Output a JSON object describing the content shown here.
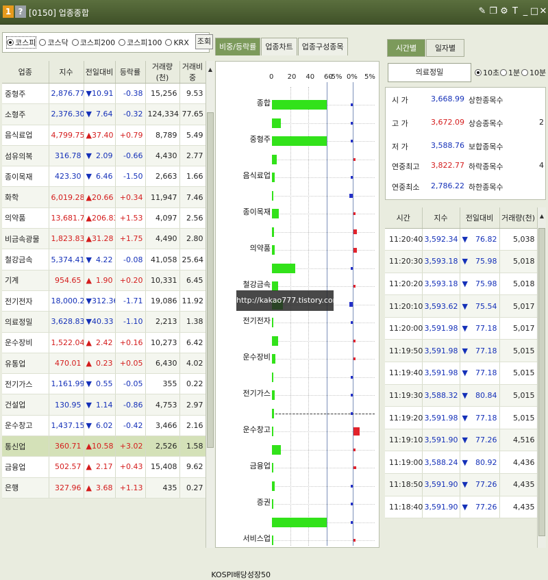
{
  "title": {
    "code": "[0150] 업종종합",
    "badge1": "1",
    "badge2": "?",
    "icons": [
      "handwrite-icon",
      "copy-icon",
      "settings-icon",
      "text-icon"
    ],
    "controls": [
      "minimize-icon",
      "maximize-icon",
      "close-icon"
    ]
  },
  "market_filter": {
    "options": [
      "코스피",
      "코스닥",
      "코스피200",
      "코스피100",
      "KRX"
    ],
    "selected": "코스피",
    "query_label": "조회"
  },
  "sector_table": {
    "headers": [
      "업종",
      "지수",
      "전일대비",
      "등락률",
      "거래량(천)",
      "거래비중"
    ],
    "rows": [
      {
        "name": "중형주",
        "index": "2,876.77",
        "arrow": "▼",
        "change": "10.91",
        "rate": "-0.38",
        "volume": "15,256",
        "share": "9.53",
        "dir": "down"
      },
      {
        "name": "소형주",
        "index": "2,376.30",
        "arrow": "▼",
        "change": "7.64",
        "rate": "-0.32",
        "volume": "124,334",
        "share": "77.65",
        "dir": "down"
      },
      {
        "name": "음식료업",
        "index": "4,799.75",
        "arrow": "▲",
        "change": "37.40",
        "rate": "+0.79",
        "volume": "8,789",
        "share": "5.49",
        "dir": "up"
      },
      {
        "name": "섬유의복",
        "index": "316.78",
        "arrow": "▼",
        "change": "2.09",
        "rate": "-0.66",
        "volume": "4,430",
        "share": "2.77",
        "dir": "down"
      },
      {
        "name": "종이목재",
        "index": "423.30",
        "arrow": "▼",
        "change": "6.46",
        "rate": "-1.50",
        "volume": "2,663",
        "share": "1.66",
        "dir": "down"
      },
      {
        "name": "화학",
        "index": "6,019.28",
        "arrow": "▲",
        "change": "20.66",
        "rate": "+0.34",
        "volume": "11,947",
        "share": "7.46",
        "dir": "up"
      },
      {
        "name": "의약품",
        "index": "13,681.7",
        "arrow": "▲",
        "change": "206.83",
        "rate": "+1.53",
        "volume": "4,097",
        "share": "2.56",
        "dir": "up"
      },
      {
        "name": "비금속광물",
        "index": "1,823.83",
        "arrow": "▲",
        "change": "31.28",
        "rate": "+1.75",
        "volume": "4,490",
        "share": "2.80",
        "dir": "up"
      },
      {
        "name": "철강금속",
        "index": "5,374.41",
        "arrow": "▼",
        "change": "4.22",
        "rate": "-0.08",
        "volume": "41,058",
        "share": "25.64",
        "dir": "down"
      },
      {
        "name": "기계",
        "index": "954.65",
        "arrow": "▲",
        "change": "1.90",
        "rate": "+0.20",
        "volume": "10,331",
        "share": "6.45",
        "dir": "up"
      },
      {
        "name": "전기전자",
        "index": "18,000.2",
        "arrow": "▼",
        "change": "312.36",
        "rate": "-1.71",
        "volume": "19,086",
        "share": "11.92",
        "dir": "down"
      },
      {
        "name": "의료정밀",
        "index": "3,628.83",
        "arrow": "▼",
        "change": "40.33",
        "rate": "-1.10",
        "volume": "2,213",
        "share": "1.38",
        "dir": "down"
      },
      {
        "name": "운수장비",
        "index": "1,522.04",
        "arrow": "▲",
        "change": "2.42",
        "rate": "+0.16",
        "volume": "10,273",
        "share": "6.42",
        "dir": "up"
      },
      {
        "name": "유통업",
        "index": "470.01",
        "arrow": "▲",
        "change": "0.23",
        "rate": "+0.05",
        "volume": "6,430",
        "share": "4.02",
        "dir": "up"
      },
      {
        "name": "전기가스",
        "index": "1,161.99",
        "arrow": "▼",
        "change": "0.55",
        "rate": "-0.05",
        "volume": "355",
        "share": "0.22",
        "dir": "down"
      },
      {
        "name": "건설업",
        "index": "130.95",
        "arrow": "▼",
        "change": "1.14",
        "rate": "-0.86",
        "volume": "4,753",
        "share": "2.97",
        "dir": "down"
      },
      {
        "name": "운수창고",
        "index": "1,437.15",
        "arrow": "▼",
        "change": "6.02",
        "rate": "-0.42",
        "volume": "3,466",
        "share": "2.16",
        "dir": "down"
      },
      {
        "name": "통신업",
        "index": "360.71",
        "arrow": "▲",
        "change": "10.58",
        "rate": "+3.02",
        "volume": "2,526",
        "share": "1.58",
        "dir": "up"
      },
      {
        "name": "금융업",
        "index": "502.57",
        "arrow": "▲",
        "change": "2.17",
        "rate": "+0.43",
        "volume": "15,408",
        "share": "9.62",
        "dir": "up"
      },
      {
        "name": "은행",
        "index": "327.96",
        "arrow": "▲",
        "change": "3.68",
        "rate": "+1.13",
        "volume": "435",
        "share": "0.27",
        "dir": "up"
      }
    ]
  },
  "chart_tabs": [
    "비중/등락률",
    "업종차트",
    "업종구성종목"
  ],
  "chart_data": {
    "type": "bar",
    "share_axis_ticks": [
      "0",
      "20",
      "40",
      "60"
    ],
    "rate_axis_ticks": [
      "-5%",
      "0%",
      "5%"
    ],
    "shown_labels": [
      "종합",
      "중형주",
      "음식료업",
      "종이목재",
      "의약품",
      "철강금속",
      "전기전자",
      "운수장비",
      "전기가스",
      "운수창고",
      "금융업",
      "증권",
      "서비스업",
      "KOSPI배당성장50"
    ],
    "series": [
      {
        "name": "거래비중",
        "values": [
          100,
          9.53,
          77.65,
          5.49,
          2.77,
          1.66,
          7.46,
          2.56,
          2.8,
          25.64,
          6.45,
          11.92,
          1.38,
          6.42,
          4.02,
          0.22,
          2.97,
          2.16,
          1.58,
          9.62,
          0.27,
          3.1,
          1.2,
          77.7,
          1.0
        ]
      },
      {
        "name": "등락률",
        "values": [
          -0.4,
          -0.38,
          -0.32,
          0.79,
          -0.66,
          -1.5,
          0.34,
          1.53,
          1.75,
          -0.08,
          0.2,
          -1.71,
          -1.1,
          0.16,
          0.05,
          -0.05,
          -0.86,
          -0.42,
          3.02,
          0.43,
          1.13,
          -0.3,
          -0.2,
          -0.4,
          0.1
        ]
      }
    ],
    "xlim_share": [
      0,
      60
    ],
    "xlim_rate": [
      -5,
      5
    ],
    "watermark": "http://kakao777.tistory.com"
  },
  "right_panel": {
    "tabs": [
      "시간별",
      "일자별"
    ],
    "sector_name": "의료정밀",
    "interval_options": [
      "10초",
      "1분",
      "10분"
    ],
    "interval_selected": "10초",
    "stats_left": [
      {
        "label": "시  가",
        "value": "3,668.99",
        "dir": "down"
      },
      {
        "label": "고  가",
        "value": "3,672.09",
        "dir": "up"
      },
      {
        "label": "저  가",
        "value": "3,588.76",
        "dir": "down"
      },
      {
        "label": "연중최고",
        "value": "3,822.77",
        "dir": "up"
      },
      {
        "label": "연중최소",
        "value": "2,786.22",
        "dir": "down"
      }
    ],
    "stats_right": [
      {
        "label": "상한종목수",
        "value": ""
      },
      {
        "label": "상승종목수",
        "value": "2"
      },
      {
        "label": "보합종목수",
        "value": ""
      },
      {
        "label": "하락종목수",
        "value": "4"
      },
      {
        "label": "하한종목수",
        "value": ""
      }
    ],
    "time_table": {
      "headers": [
        "시간",
        "지수",
        "전일대비",
        "거래량(천)"
      ],
      "rows": [
        {
          "time": "11:20:40",
          "index": "3,592.34",
          "arrow": "▼",
          "change": "76.82",
          "volume": "5,038"
        },
        {
          "time": "11:20:30",
          "index": "3,593.18",
          "arrow": "▼",
          "change": "75.98",
          "volume": "5,018"
        },
        {
          "time": "11:20:20",
          "index": "3,593.18",
          "arrow": "▼",
          "change": "75.98",
          "volume": "5,018"
        },
        {
          "time": "11:20:10",
          "index": "3,593.62",
          "arrow": "▼",
          "change": "75.54",
          "volume": "5,017"
        },
        {
          "time": "11:20:00",
          "index": "3,591.98",
          "arrow": "▼",
          "change": "77.18",
          "volume": "5,017"
        },
        {
          "time": "11:19:50",
          "index": "3,591.98",
          "arrow": "▼",
          "change": "77.18",
          "volume": "5,015"
        },
        {
          "time": "11:19:40",
          "index": "3,591.98",
          "arrow": "▼",
          "change": "77.18",
          "volume": "5,015"
        },
        {
          "time": "11:19:30",
          "index": "3,588.32",
          "arrow": "▼",
          "change": "80.84",
          "volume": "5,015"
        },
        {
          "time": "11:19:20",
          "index": "3,591.98",
          "arrow": "▼",
          "change": "77.18",
          "volume": "5,015"
        },
        {
          "time": "11:19:10",
          "index": "3,591.90",
          "arrow": "▼",
          "change": "77.26",
          "volume": "4,516"
        },
        {
          "time": "11:19:00",
          "index": "3,588.24",
          "arrow": "▼",
          "change": "80.92",
          "volume": "4,436"
        },
        {
          "time": "11:18:50",
          "index": "3,591.90",
          "arrow": "▼",
          "change": "77.26",
          "volume": "4,435"
        },
        {
          "time": "11:18:40",
          "index": "3,591.90",
          "arrow": "▼",
          "change": "77.26",
          "volume": "4,435"
        }
      ]
    }
  },
  "colors": {
    "up": "#d41c1c",
    "down": "#1430b8",
    "accent": "#7c9a5b",
    "bar_green": "#32e21a",
    "highlight_row": "#d4e1b8"
  }
}
